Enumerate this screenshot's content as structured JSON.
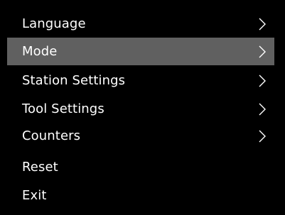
{
  "menu": {
    "items": [
      {
        "label": "Language",
        "has_submenu": true,
        "selected": false
      },
      {
        "label": "Mode",
        "has_submenu": true,
        "selected": true
      },
      {
        "label": "Station Settings",
        "has_submenu": true,
        "selected": false
      },
      {
        "label": "Tool Settings",
        "has_submenu": true,
        "selected": false
      },
      {
        "label": "Counters",
        "has_submenu": true,
        "selected": false
      },
      {
        "label": "Reset",
        "has_submenu": false,
        "selected": false
      },
      {
        "label": "Exit",
        "has_submenu": false,
        "selected": false
      }
    ]
  },
  "colors": {
    "background": "#000000",
    "text": "#ffffff",
    "selected_background": "#606060"
  },
  "icons": {
    "submenu_indicator": "chevron-right-icon"
  }
}
